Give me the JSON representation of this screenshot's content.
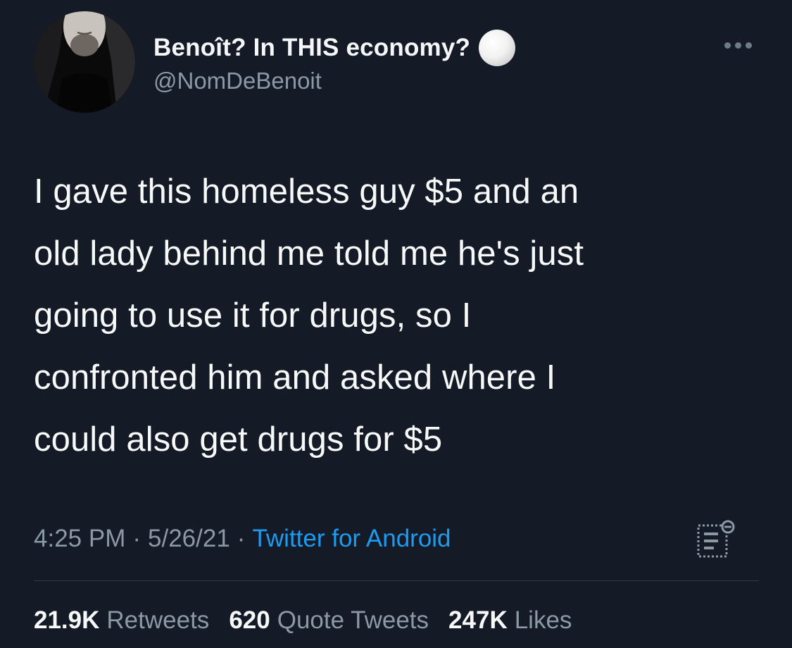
{
  "tweet": {
    "author": {
      "display_name": "Benoît? In THIS economy?",
      "handle": "@NomDeBenoit",
      "name_emoji": "white-circle"
    },
    "text": "I gave this homeless guy $5 and an\nold lady behind me told me he's just\ngoing to use it for drugs, so I\nconfronted him and asked where I\ncould also get drugs for $5",
    "time": "4:25 PM",
    "date": "5/26/21",
    "source": "Twitter for Android",
    "separator": "·",
    "stats": {
      "retweets": {
        "count": "21.9K",
        "label": "Retweets"
      },
      "quote_tweets": {
        "count": "620",
        "label": "Quote Tweets"
      },
      "likes": {
        "count": "247K",
        "label": "Likes"
      }
    }
  },
  "icons": {
    "more": "more-horizontal-icon",
    "analytics": "view-activity-icon"
  },
  "colors": {
    "background": "#151b26",
    "text_primary": "#f7f9f9",
    "text_secondary": "#8b98a5",
    "link": "#1d9bf0",
    "divider": "#2f3a47"
  }
}
